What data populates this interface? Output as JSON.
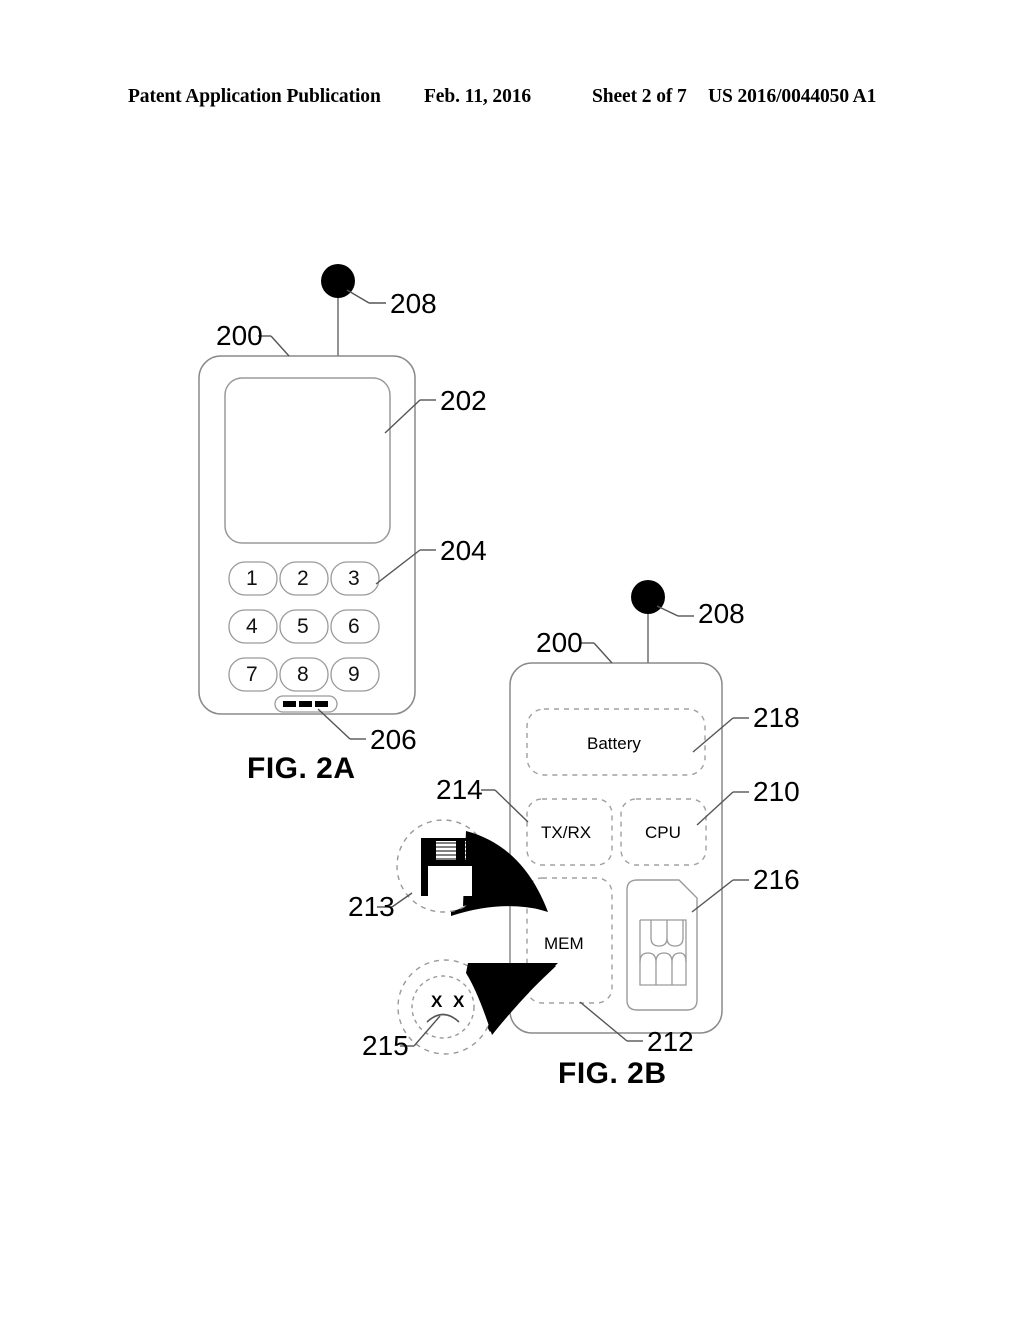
{
  "header": {
    "publication": "Patent Application Publication",
    "date": "Feb. 11, 2016",
    "sheet": "Sheet 2 of 7",
    "patent_number": "US 2016/0044050 A1"
  },
  "figures": [
    {
      "caption": "FIG. 2A",
      "description": "Front view of mobile device with display and keypad"
    },
    {
      "caption": "FIG. 2B",
      "description": "Internal block diagram of mobile device"
    }
  ],
  "fig2a": {
    "caption": "FIG. 2A",
    "reference_numbers": {
      "device_body": "200",
      "display": "202",
      "keypad": "204",
      "speaker": "206",
      "antenna": "208"
    },
    "keypad_keys": [
      "1",
      "2",
      "3",
      "4",
      "5",
      "6",
      "7",
      "8",
      "9"
    ]
  },
  "fig2b": {
    "caption": "FIG. 2B",
    "reference_numbers": {
      "device_body": "200",
      "antenna": "208",
      "cpu": "210",
      "memory": "212",
      "floppy_callout": "213",
      "transceiver": "214",
      "sadface_callout": "215",
      "sim_card": "216",
      "battery": "218"
    },
    "blocks": [
      {
        "id": "battery",
        "label": "Battery"
      },
      {
        "id": "transceiver",
        "label": "TX/RX"
      },
      {
        "id": "cpu",
        "label": "CPU"
      },
      {
        "id": "memory",
        "label": "MEM"
      }
    ],
    "callouts": [
      {
        "id": "floppy",
        "ref": "213",
        "icon": "floppy-disk-icon",
        "text": ""
      },
      {
        "id": "sadface",
        "ref": "215",
        "icon": "sad-face-icon",
        "text": "X X"
      }
    ],
    "sim_icon": "sim-card-icon"
  },
  "colors": {
    "ink": "#000000",
    "line": "#888888",
    "dashed_line": "#999999",
    "background": "#ffffff"
  }
}
